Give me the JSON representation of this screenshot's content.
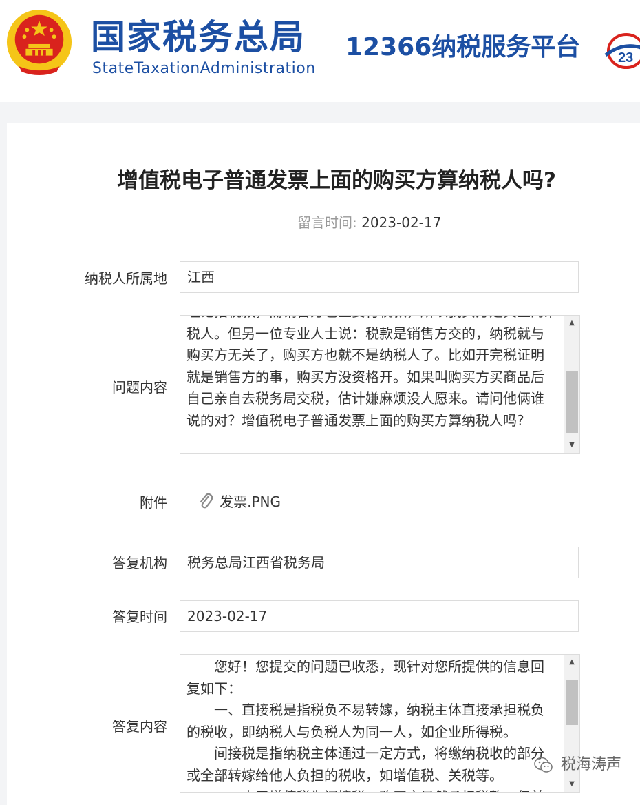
{
  "header": {
    "org_name_cn": "国家税务总局",
    "org_name_en": "StateTaxationAdministration",
    "hotline_title": "12366纳税服务平台",
    "emblem_icon": "national-emblem-icon",
    "hotline_logo_icon": "12366-logo-icon",
    "brand_color": "#1c4fa3"
  },
  "question": {
    "title": "增值税电子普通发票上面的购买方算纳税人吗?",
    "post_time_label": "留言时间:",
    "post_time_value": "2023-02-17",
    "region_label": "纳税人所属地",
    "region_value": "江西",
    "content_label": "问题内容",
    "content_top_partial": "理论指税款，而销售方也主要付税款，所以我买方是真正的纳",
    "content_text": "税人。但另一位专业人士说：税款是销售方交的，纳税就与购买方无关了，购买方也就不是纳税人了。比如开完税证明就是销售方的事，购买方没资格开。如果叫购买方买商品后自己亲自去税务局交税，估计嫌麻烦没人愿来。请问他俩谁说的对？增值税电子普通发票上面的购买方算纳税人吗?",
    "attachment_label": "附件",
    "attachment_icon": "paperclip-icon",
    "attachment_name": "发票.PNG"
  },
  "reply": {
    "org_label": "答复机构",
    "org_value": "税务总局江西省税务局",
    "time_label": "答复时间",
    "time_value": "2023-02-17",
    "content_label": "答复内容",
    "paragraphs": [
      "您好！您提交的问题已收悉，现针对您所提供的信息回复如下：",
      "一、直接税是指税负不易转嫁，纳税主体直接承担税负的税收，即纳税人与负税人为同一人，如企业所得税。",
      "间接税是指纳税主体通过一定方式，将缴纳税收的部分或全部转嫁给他人负担的税收，如增值税、关税等。"
    ],
    "bottom_partial": "二、由于增值税为间接税，购买方虽然承担税款，但并不是增值税纳税人。"
  },
  "watermark": {
    "icon": "wechat-icon",
    "text": "税海涛声"
  }
}
